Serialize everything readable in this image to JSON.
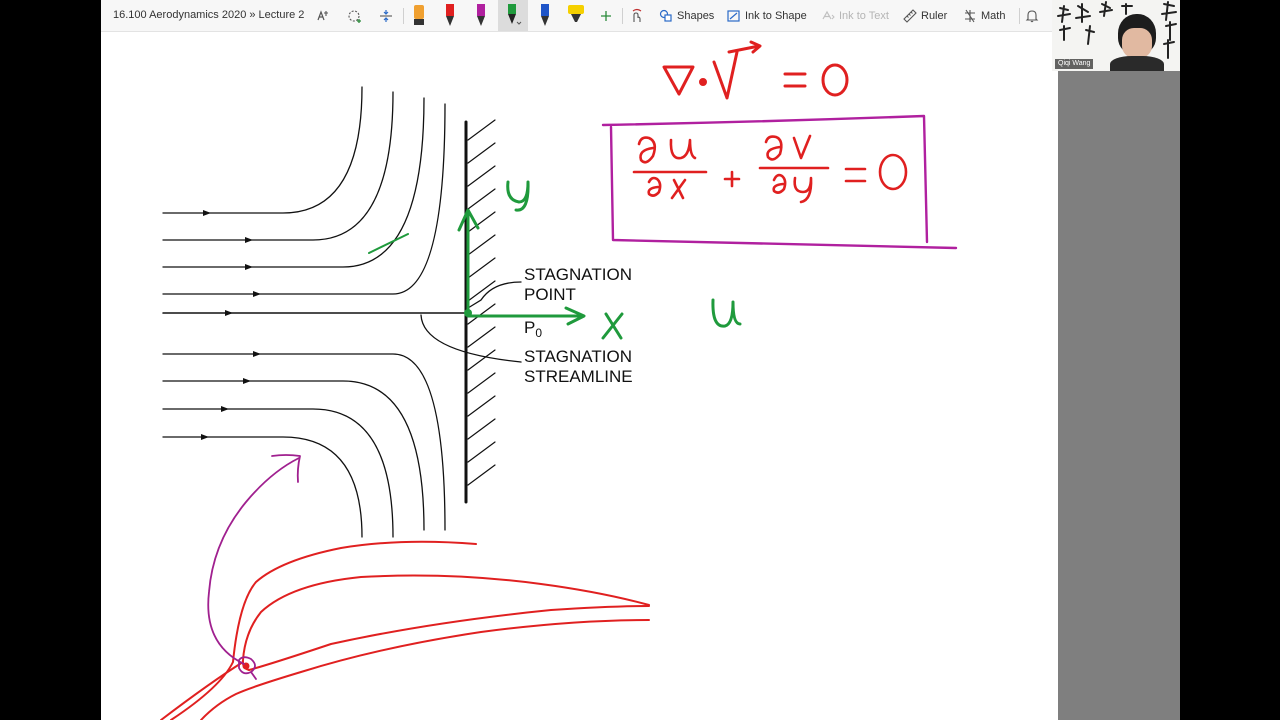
{
  "app": {
    "doc_title": "16.100 Aerodynamics 2020 » Lecture 2",
    "toolbar": {
      "tools": [
        {
          "name": "lasso-select-icon"
        },
        {
          "name": "add-space-icon"
        },
        {
          "name": "insert-space-icon"
        }
      ],
      "pens": [
        {
          "name": "orange-highlighter",
          "color": "#f0a030"
        },
        {
          "name": "red-pen",
          "color": "#e02020"
        },
        {
          "name": "magenta-pen",
          "color": "#b0209f"
        },
        {
          "name": "green-pen",
          "color": "#1f9a3c",
          "selected": true
        },
        {
          "name": "blue-pen",
          "color": "#1f55c8"
        },
        {
          "name": "yellow-highlighter",
          "color": "#f5d000"
        }
      ],
      "shapes_label": "Shapes",
      "ink_to_shape_label": "Ink to Shape",
      "ink_to_text_label": "Ink to Text",
      "ruler_label": "Ruler",
      "math_label": "Math"
    }
  },
  "diagram": {
    "labels": {
      "stagnation_point_line1": "STAGNATION",
      "stagnation_point_line2": "POINT",
      "p0_base": "P",
      "p0_sub": "0",
      "stagnation_streamline_line1": "STAGNATION",
      "stagnation_streamline_line2": "STREAMLINE"
    },
    "colors": {
      "red_ink": "#e02020",
      "green_ink": "#1f9a3c",
      "magenta_ink": "#a0208f",
      "black_ink": "#111111"
    }
  },
  "webcam": {
    "participant_name": "Qiqi Wang"
  }
}
